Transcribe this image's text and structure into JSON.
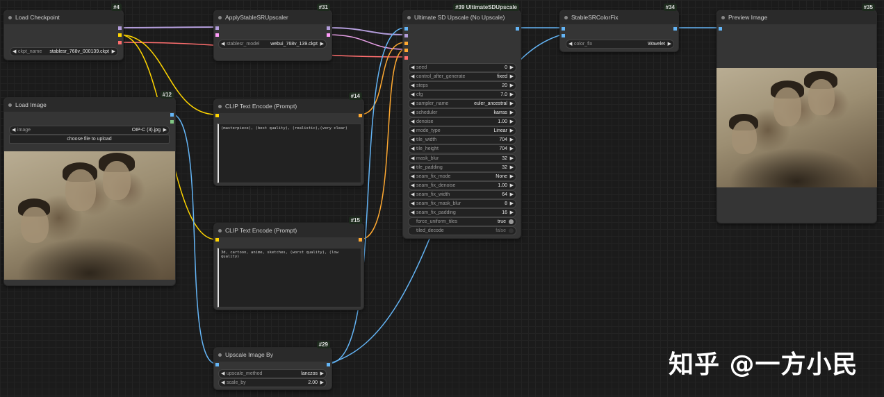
{
  "nodes": {
    "load_checkpoint": {
      "title": "Load Checkpoint",
      "id": "#4",
      "widgets": {
        "ckpt_name": {
          "label": "ckpt_name",
          "value": "stablesr_768v_000139.ckpt"
        }
      }
    },
    "apply_sr": {
      "title": "ApplyStableSRUpscaler",
      "id": "#31",
      "widgets": {
        "stablesr_model": {
          "label": "stablesr_model",
          "value": "webui_768v_139.ckpt"
        }
      }
    },
    "ultimate": {
      "title": "Ultimate SD Upscale (No Upscale)",
      "id": "#39 UltimateSDUpscale",
      "widgets": [
        {
          "label": "seed",
          "value": "0"
        },
        {
          "label": "control_after_generate",
          "value": "fixed"
        },
        {
          "label": "steps",
          "value": "20"
        },
        {
          "label": "cfg",
          "value": "7.0"
        },
        {
          "label": "sampler_name",
          "value": "euler_ancestral"
        },
        {
          "label": "scheduler",
          "value": "karras"
        },
        {
          "label": "denoise",
          "value": "1.00"
        },
        {
          "label": "mode_type",
          "value": "Linear"
        },
        {
          "label": "tile_width",
          "value": "704"
        },
        {
          "label": "tile_height",
          "value": "704"
        },
        {
          "label": "mask_blur",
          "value": "32"
        },
        {
          "label": "tile_padding",
          "value": "32"
        },
        {
          "label": "seam_fix_mode",
          "value": "None"
        },
        {
          "label": "seam_fix_denoise",
          "value": "1.00"
        },
        {
          "label": "seam_fix_width",
          "value": "64"
        },
        {
          "label": "seam_fix_mask_blur",
          "value": "8"
        },
        {
          "label": "seam_fix_padding",
          "value": "16"
        }
      ],
      "toggles": [
        {
          "label": "force_uniform_tiles",
          "value": "true"
        },
        {
          "label": "tiled_decode",
          "value": "false"
        }
      ]
    },
    "colorfix": {
      "title": "StableSRColorFix",
      "id": "#34",
      "widgets": {
        "color_fix": {
          "label": "color_fix",
          "value": "Wavelet"
        }
      }
    },
    "preview": {
      "title": "Preview Image",
      "id": "#35"
    },
    "load_image": {
      "title": "Load Image",
      "id": "#12",
      "widgets": {
        "image": {
          "label": "image",
          "value": "OIP-C (3).jpg"
        }
      },
      "upload_label": "choose file to upload"
    },
    "clip_pos": {
      "title": "CLIP Text Encode (Prompt)",
      "id": "#14",
      "text": "(masterpiece), (best quality), (realistic),(very clear)"
    },
    "clip_neg": {
      "title": "CLIP Text Encode (Prompt)",
      "id": "#15",
      "text": "3d, cartoon, anime, sketches, (worst quality), (low quality)"
    },
    "upscale_by": {
      "title": "Upscale Image By",
      "id": "#29",
      "widgets": {
        "upscale_method": {
          "label": "upscale_method",
          "value": "lanczos"
        },
        "scale_by": {
          "label": "scale_by",
          "value": "2.00"
        }
      }
    }
  },
  "watermark": "知乎 @一方小民",
  "colors": {
    "model": "#b39ddb",
    "clip": "#ffd500",
    "vae": "#ff6e6e",
    "image": "#64b5f6",
    "conditioning": "#ffa931",
    "latent": "#ff9cf9",
    "bg": "#1b1b1b",
    "node": "#353535"
  }
}
